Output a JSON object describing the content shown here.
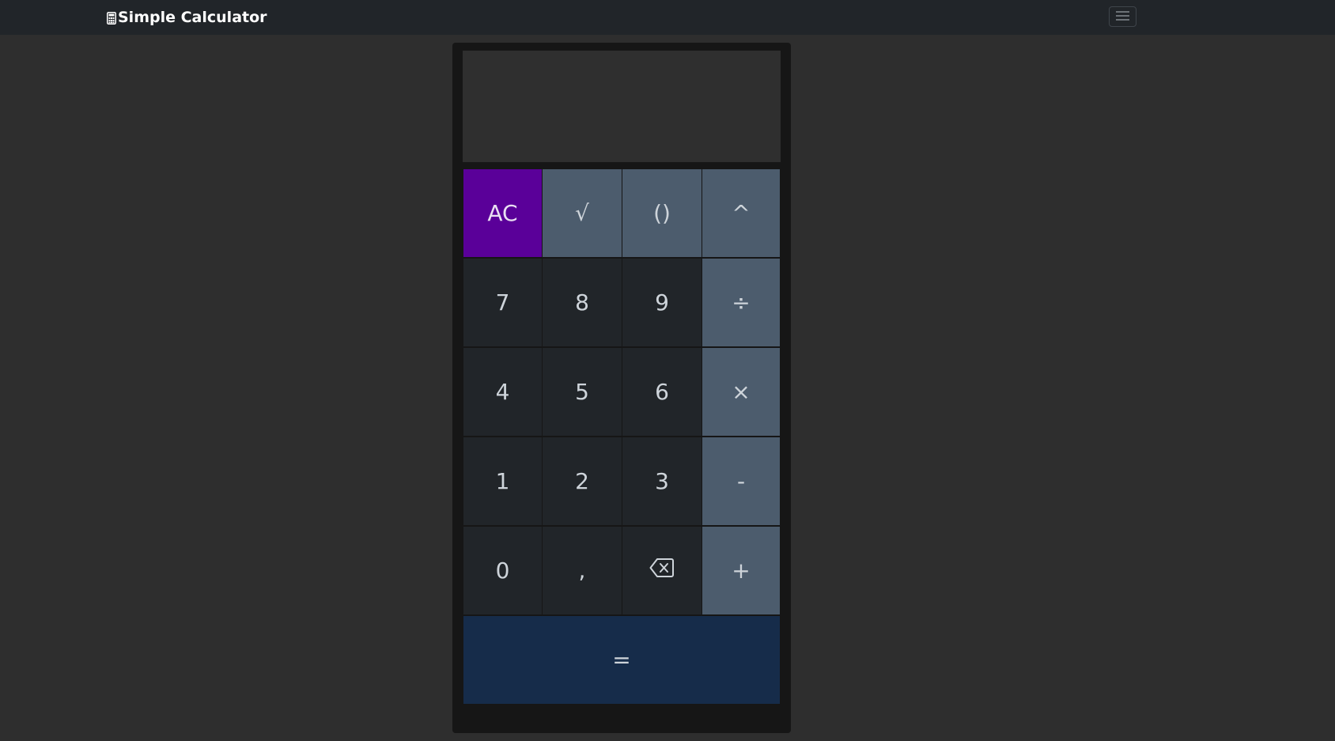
{
  "navbar": {
    "brand": "Simple Calculator",
    "brand_icon": "calculator-icon",
    "toggler_icon": "hamburger-menu-icon",
    "bg_color": "#212529"
  },
  "display": {
    "value": ""
  },
  "keys": {
    "clear": "AC",
    "sqrt": "√",
    "parens": "()",
    "power": "^",
    "seven": "7",
    "eight": "8",
    "nine": "9",
    "divide": "÷",
    "four": "4",
    "five": "5",
    "six": "6",
    "multiply": "×",
    "one": "1",
    "two": "2",
    "three": "3",
    "minus": "-",
    "zero": "0",
    "comma": ",",
    "backspace_icon": "backspace-icon",
    "plus": "+",
    "equals": "="
  },
  "colors": {
    "clear_key": "#5a0099",
    "operator_key": "#4c5c6d",
    "number_key": "#212529",
    "equals_key": "#162c4a",
    "page_bg": "#2e2e2e"
  }
}
